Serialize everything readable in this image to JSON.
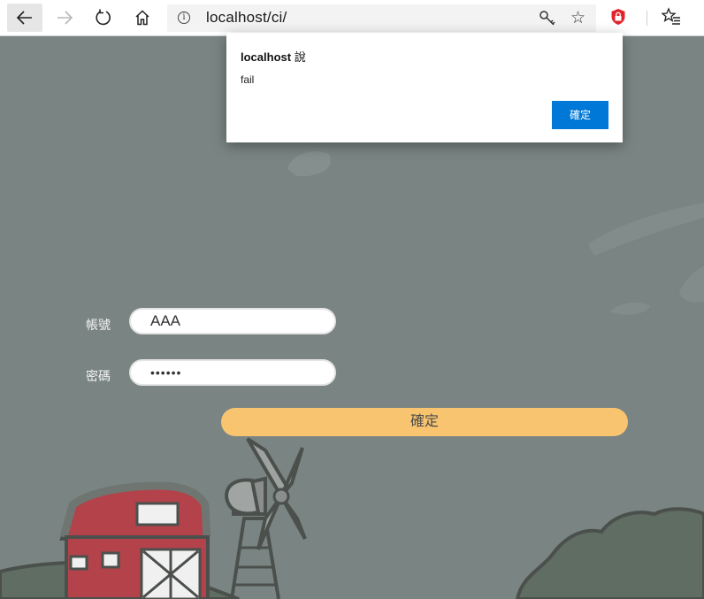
{
  "browser": {
    "url": "localhost/ci/"
  },
  "dialog": {
    "title_host": "localhost",
    "title_suffix": " 說",
    "message": "fail",
    "ok_label": "確定"
  },
  "login": {
    "username_label": "帳號",
    "username_value": "AAA",
    "password_label": "密碼",
    "password_masked": "••••••",
    "submit_label": "確定"
  },
  "colors": {
    "page_bg": "#7a8583",
    "submit_button": "#f9c46f",
    "dialog_button": "#0078d7",
    "barn_red": "#b3424a"
  }
}
